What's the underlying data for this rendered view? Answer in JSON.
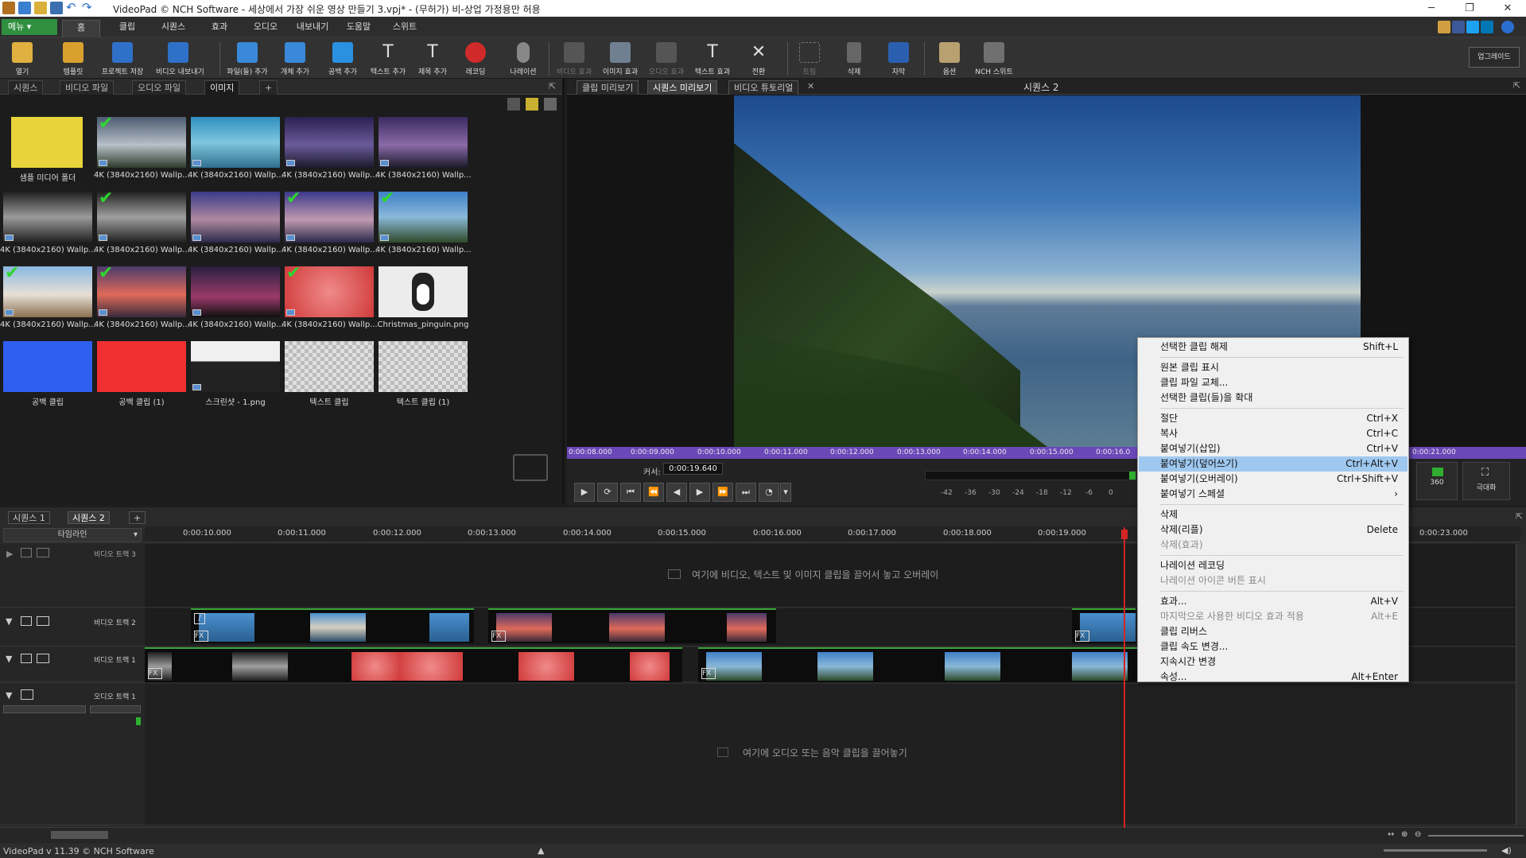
{
  "window": {
    "title": "VideoPad © NCH Software - 세상에서 가장 쉬운 영상 만들기 3.vpj* - (무허가) 비-상업 가정용만 허용",
    "controls": [
      "─",
      "❐",
      "✕"
    ]
  },
  "ribbon_tabs": [
    "메뉴 ▾",
    "홈",
    "클립",
    "시퀀스",
    "효과",
    "오디오",
    "내보내기",
    "도움말",
    "스위트"
  ],
  "toolbar": {
    "buttons": [
      "열기",
      "템플릿",
      "프로젝트 저장",
      "비디오 내보내기",
      "파일(들) 추가",
      "개체 추가",
      "공백 추가",
      "텍스트 추가",
      "제목 추가",
      "레코딩",
      "나레이션",
      "비디오 효과",
      "이미지 효과",
      "오디오 효과",
      "텍스트 효과",
      "전환",
      "트림",
      "삭제",
      "자막",
      "옵션",
      "NCH 스위트"
    ],
    "upgrade": "업그레이드"
  },
  "bin": {
    "tabs": [
      "시퀀스",
      "비디오 파일",
      "오디오 파일",
      "이미지"
    ],
    "add_tab": "+",
    "items": [
      {
        "caption": "샘플 미디어 폴더",
        "checked": false
      },
      {
        "caption": "4K (3840x2160) Wallp...",
        "checked": true
      },
      {
        "caption": "4K (3840x2160) Wallp...",
        "checked": false
      },
      {
        "caption": "4K (3840x2160) Wallp...",
        "checked": false
      },
      {
        "caption": "4K (3840x2160) Wallp...",
        "checked": false
      },
      {
        "caption": "4K (3840x2160) Wallp...",
        "checked": false
      },
      {
        "caption": "4K (3840x2160) Wallp...",
        "checked": true
      },
      {
        "caption": "4K (3840x2160) Wallp...",
        "checked": false
      },
      {
        "caption": "4K (3840x2160) Wallp...",
        "checked": true
      },
      {
        "caption": "4K (3840x2160) Wallp...",
        "checked": true
      },
      {
        "caption": "4K (3840x2160) Wallp...",
        "checked": true
      },
      {
        "caption": "4K (3840x2160) Wallp...",
        "checked": true
      },
      {
        "caption": "4K (3840x2160) Wallp...",
        "checked": false
      },
      {
        "caption": "4K (3840x2160) Wallp...",
        "checked": true
      },
      {
        "caption": "Christmas_pinguin.png",
        "checked": false
      },
      {
        "caption": "공백 클립",
        "checked": false
      },
      {
        "caption": "공백 클립 (1)",
        "checked": false
      },
      {
        "caption": "스크린샷 - 1.png",
        "checked": false
      },
      {
        "caption": "텍스트 클립",
        "checked": false
      },
      {
        "caption": "텍스트 클립 (1)",
        "checked": false
      }
    ]
  },
  "preview": {
    "tabs": [
      "클립 미리보기",
      "시퀀스 미리보기",
      "비디오 튜토리얼"
    ],
    "sequence_title": "시퀀스 2",
    "ruler": [
      "0:00:08.000",
      "0:00:09.000",
      "0:00:10.000",
      "0:00:11.000",
      "0:00:12.000",
      "0:00:13.000",
      "0:00:14.000",
      "0:00:15.000",
      "0:00:16.0",
      "0:00:21.000"
    ],
    "cursor_label": "커서:",
    "cursor_value": "0:00:19.640",
    "meter": [
      "-42",
      "-36",
      "-30",
      "-24",
      "-18",
      "-12",
      "-6",
      "0"
    ],
    "btn_360": "360",
    "btn_expand": "극대화"
  },
  "timeline": {
    "tabs": [
      "시퀀스 1",
      "시퀀스 2"
    ],
    "add_tab": "+",
    "mode": "타임라인",
    "ruler": [
      "0:00:10.000",
      "0:00:11.000",
      "0:00:12.000",
      "0:00:13.000",
      "0:00:14.000",
      "0:00:15.000",
      "0:00:16.000",
      "0:00:17.000",
      "0:00:18.000",
      "0:00:19.000",
      "0:00:23.000"
    ],
    "tracks": {
      "video3": "비디오 트랙 3",
      "video2": "비디오 트랙 2",
      "video1": "비디오 트랙 1",
      "audio1": "오디오 트랙 1"
    },
    "video_hint": "여기에 비디오, 텍스트 및 이미지 클립을 끌어서 놓고 오버레이",
    "audio_hint": "여기에 오디오 또는 음악 클립을 끌어놓기"
  },
  "status": {
    "version": "VideoPad v 11.39 © NCH Software"
  },
  "context_menu": [
    {
      "label": "선택한 클립 해제",
      "shortcut": "Shift+L"
    },
    {
      "sep": true
    },
    {
      "label": "원본 클립 표시"
    },
    {
      "label": "클립 파일 교체..."
    },
    {
      "label": "선택한 클립(들)을 확대"
    },
    {
      "sep": true
    },
    {
      "label": "절단",
      "shortcut": "Ctrl+X"
    },
    {
      "label": "복사",
      "shortcut": "Ctrl+C"
    },
    {
      "label": "붙여넣기(삽입)",
      "shortcut": "Ctrl+V"
    },
    {
      "label": "붙여넣기(덮어쓰기)",
      "shortcut": "Ctrl+Alt+V",
      "highlighted": true
    },
    {
      "label": "붙여넣기(오버레이)",
      "shortcut": "Ctrl+Shift+V"
    },
    {
      "label": "붙여넣기 스페셜",
      "shortcut": "›"
    },
    {
      "sep": true
    },
    {
      "label": "삭제"
    },
    {
      "label": "삭제(리플)",
      "shortcut": "Delete"
    },
    {
      "label": "삭제(효과)",
      "disabled": true
    },
    {
      "sep": true
    },
    {
      "label": "나레이션 레코딩"
    },
    {
      "label": "나레이션 아이콘 버튼 표시",
      "disabled": true
    },
    {
      "sep": true
    },
    {
      "label": "효과...",
      "shortcut": "Alt+V"
    },
    {
      "label": "마지막으로 사용한 비디오 효과 적용",
      "shortcut": "Alt+E",
      "disabled": true
    },
    {
      "label": "클립 리버스"
    },
    {
      "label": "클립 속도 변경..."
    },
    {
      "label": "지속시간 변경"
    },
    {
      "label": "속성...",
      "shortcut": "Alt+Enter"
    }
  ]
}
